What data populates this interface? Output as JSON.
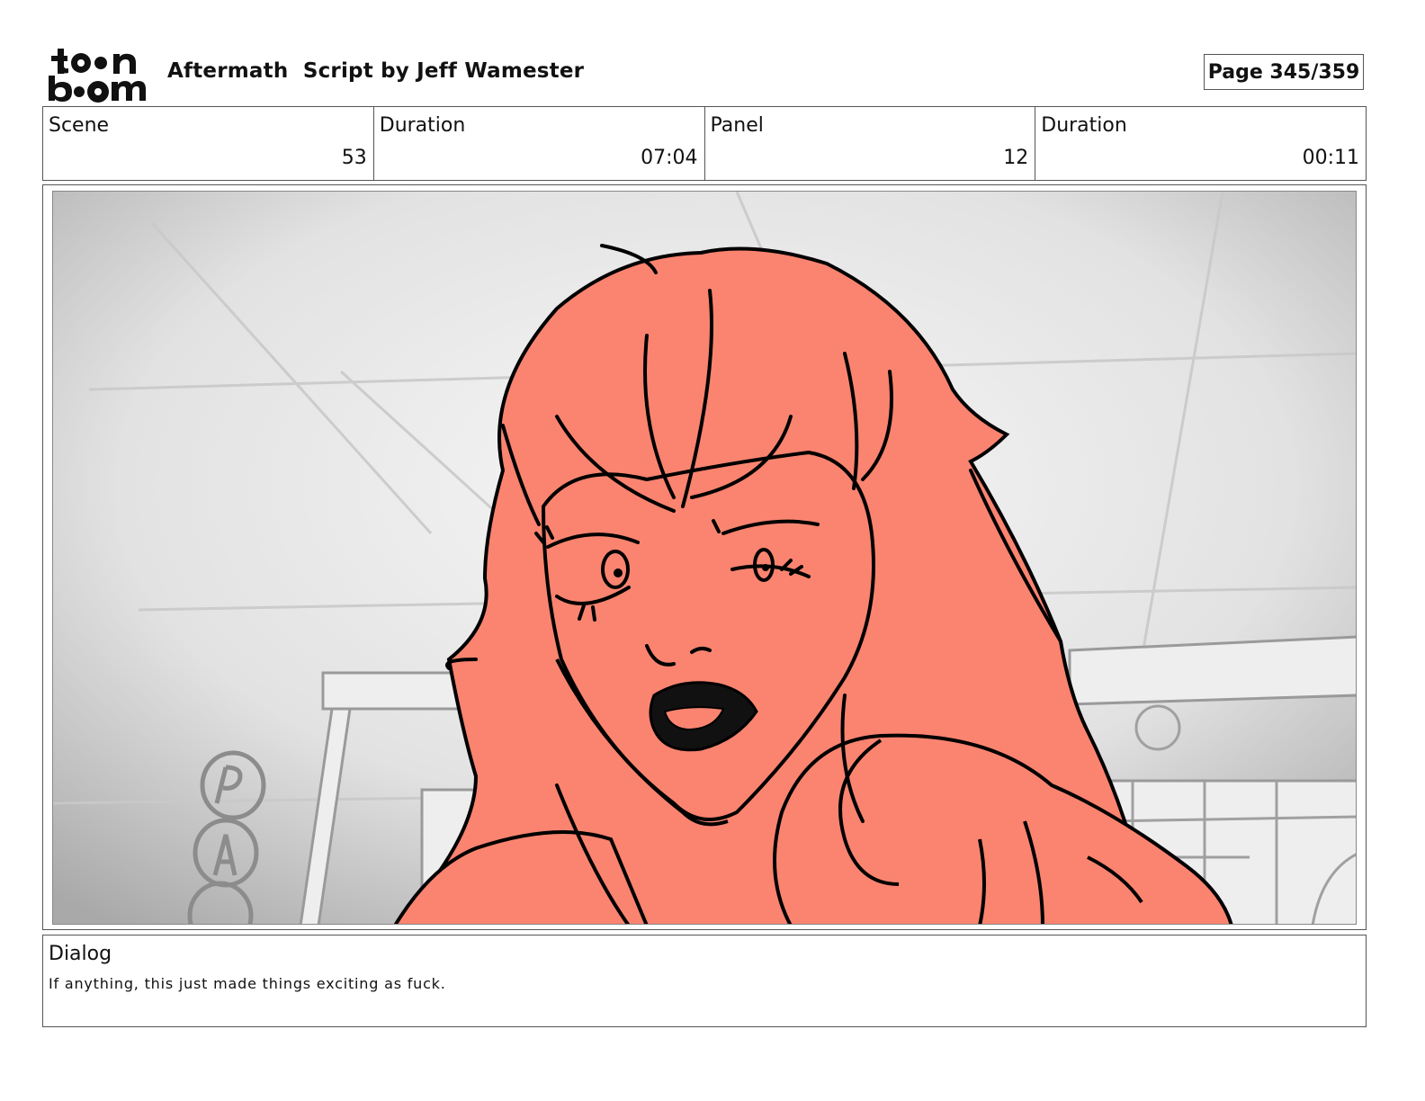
{
  "header": {
    "logo_text": "toon boom",
    "title": "Aftermath  Script by Jeff Wamester",
    "page": "Page 345/359"
  },
  "info": {
    "scene_label": "Scene",
    "scene_value": "53",
    "scene_duration_label": "Duration",
    "scene_duration_value": "07:04",
    "panel_label": "Panel",
    "panel_value": "12",
    "panel_duration_label": "Duration",
    "panel_duration_value": "00:11"
  },
  "panel_image": {
    "icon": "storyboard-drawing",
    "colors": {
      "hair_skin": "#fa8470",
      "line": "#000000",
      "background": "#d9d9d9"
    }
  },
  "dialog": {
    "label": "Dialog",
    "text": "If anything, this just made things exciting as fuck."
  }
}
